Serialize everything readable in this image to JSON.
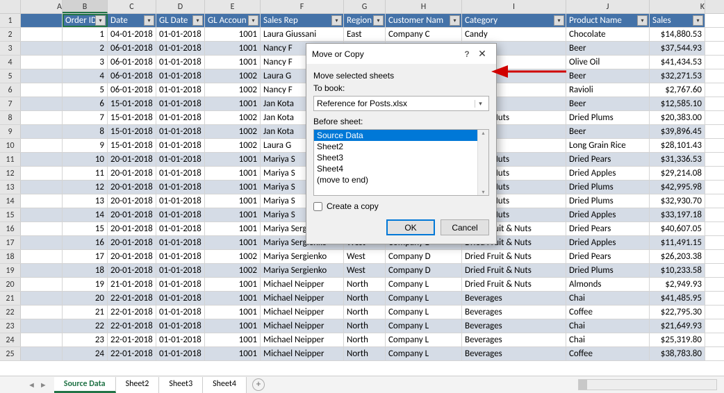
{
  "columns": [
    "A",
    "B",
    "C",
    "D",
    "E",
    "F",
    "G",
    "H",
    "I",
    "J",
    "K"
  ],
  "headers": [
    "",
    "Order ID",
    "Date",
    "GL Date",
    "GL Accoun",
    "Sales Rep",
    "Region",
    "Customer Nam",
    "Category",
    "Product Name",
    "Sales"
  ],
  "rows": [
    {
      "n": 1,
      "a": "",
      "b": "1",
      "c": "04-01-2018",
      "d": "01-01-2018",
      "e": "1001",
      "f": "Laura Giussani",
      "g": "East",
      "h": "Company C",
      "i": "Candy",
      "j": "Chocolate",
      "k": "$14,880.53"
    },
    {
      "n": 2,
      "a": "",
      "b": "2",
      "c": "06-01-2018",
      "d": "01-01-2018",
      "e": "1001",
      "f": "Nancy F",
      "g": "",
      "h": "",
      "i": "ges",
      "j": "Beer",
      "k": "$37,544.93"
    },
    {
      "n": 3,
      "a": "",
      "b": "3",
      "c": "06-01-2018",
      "d": "01-01-2018",
      "e": "1001",
      "f": "Nancy F",
      "g": "",
      "h": "",
      "i": "",
      "j": "Olive Oil",
      "k": "$41,434.53"
    },
    {
      "n": 4,
      "a": "",
      "b": "4",
      "c": "06-01-2018",
      "d": "01-01-2018",
      "e": "1002",
      "f": "Laura G",
      "g": "",
      "h": "",
      "i": "ges",
      "j": "Beer",
      "k": "$32,271.53"
    },
    {
      "n": 5,
      "a": "",
      "b": "5",
      "c": "06-01-2018",
      "d": "01-01-2018",
      "e": "1002",
      "f": "Nancy F",
      "g": "",
      "h": "",
      "i": "",
      "j": "Ravioli",
      "k": "$2,767.60"
    },
    {
      "n": 6,
      "a": "",
      "b": "6",
      "c": "15-01-2018",
      "d": "01-01-2018",
      "e": "1001",
      "f": "Jan Kota",
      "g": "",
      "h": "",
      "i": "ges",
      "j": "Beer",
      "k": "$12,585.10"
    },
    {
      "n": 7,
      "a": "",
      "b": "7",
      "c": "15-01-2018",
      "d": "01-01-2018",
      "e": "1002",
      "f": "Jan Kota",
      "g": "",
      "h": "",
      "i": "Fruit & Nuts",
      "j": "Dried Plums",
      "k": "$20,383.00"
    },
    {
      "n": 8,
      "a": "",
      "b": "8",
      "c": "15-01-2018",
      "d": "01-01-2018",
      "e": "1002",
      "f": "Jan Kota",
      "g": "",
      "h": "",
      "i": "ges",
      "j": "Beer",
      "k": "$39,896.45"
    },
    {
      "n": 9,
      "a": "",
      "b": "9",
      "c": "15-01-2018",
      "d": "01-01-2018",
      "e": "1002",
      "f": "Laura G",
      "g": "",
      "h": "",
      "i": "",
      "j": "Long Grain Rice",
      "k": "$28,101.43"
    },
    {
      "n": 10,
      "a": "",
      "b": "10",
      "c": "20-01-2018",
      "d": "01-01-2018",
      "e": "1001",
      "f": "Mariya S",
      "g": "",
      "h": "",
      "i": "Fruit & Nuts",
      "j": "Dried Pears",
      "k": "$31,336.53"
    },
    {
      "n": 11,
      "a": "",
      "b": "11",
      "c": "20-01-2018",
      "d": "01-01-2018",
      "e": "1001",
      "f": "Mariya S",
      "g": "",
      "h": "",
      "i": "Fruit & Nuts",
      "j": "Dried Apples",
      "k": "$29,214.08"
    },
    {
      "n": 12,
      "a": "",
      "b": "12",
      "c": "20-01-2018",
      "d": "01-01-2018",
      "e": "1001",
      "f": "Mariya S",
      "g": "",
      "h": "",
      "i": "Fruit & Nuts",
      "j": "Dried Plums",
      "k": "$42,995.98"
    },
    {
      "n": 13,
      "a": "",
      "b": "13",
      "c": "20-01-2018",
      "d": "01-01-2018",
      "e": "1001",
      "f": "Mariya S",
      "g": "",
      "h": "",
      "i": "Fruit & Nuts",
      "j": "Dried Plums",
      "k": "$32,930.70"
    },
    {
      "n": 14,
      "a": "",
      "b": "14",
      "c": "20-01-2018",
      "d": "01-01-2018",
      "e": "1001",
      "f": "Mariya S",
      "g": "",
      "h": "",
      "i": "Fruit & Nuts",
      "j": "Dried Apples",
      "k": "$33,197.18"
    },
    {
      "n": 15,
      "a": "",
      "b": "15",
      "c": "20-01-2018",
      "d": "01-01-2018",
      "e": "1001",
      "f": "Mariya Sergienko",
      "g": "West",
      "h": "Company D",
      "i": "Dried Fruit & Nuts",
      "j": "Dried Pears",
      "k": "$40,607.05"
    },
    {
      "n": 16,
      "a": "",
      "b": "16",
      "c": "20-01-2018",
      "d": "01-01-2018",
      "e": "1001",
      "f": "Mariya Sergienko",
      "g": "West",
      "h": "Company D",
      "i": "Dried Fruit & Nuts",
      "j": "Dried Apples",
      "k": "$11,491.15"
    },
    {
      "n": 17,
      "a": "",
      "b": "17",
      "c": "20-01-2018",
      "d": "01-01-2018",
      "e": "1002",
      "f": "Mariya Sergienko",
      "g": "West",
      "h": "Company D",
      "i": "Dried Fruit & Nuts",
      "j": "Dried Pears",
      "k": "$26,203.38"
    },
    {
      "n": 18,
      "a": "",
      "b": "18",
      "c": "20-01-2018",
      "d": "01-01-2018",
      "e": "1002",
      "f": "Mariya Sergienko",
      "g": "West",
      "h": "Company D",
      "i": "Dried Fruit & Nuts",
      "j": "Dried Plums",
      "k": "$10,233.58"
    },
    {
      "n": 19,
      "a": "",
      "b": "19",
      "c": "21-01-2018",
      "d": "01-01-2018",
      "e": "1001",
      "f": "Michael Neipper",
      "g": "North",
      "h": "Company L",
      "i": "Dried Fruit & Nuts",
      "j": "Almonds",
      "k": "$2,949.93"
    },
    {
      "n": 20,
      "a": "",
      "b": "20",
      "c": "22-01-2018",
      "d": "01-01-2018",
      "e": "1001",
      "f": "Michael Neipper",
      "g": "North",
      "h": "Company L",
      "i": "Beverages",
      "j": "Chai",
      "k": "$41,485.95"
    },
    {
      "n": 21,
      "a": "",
      "b": "21",
      "c": "22-01-2018",
      "d": "01-01-2018",
      "e": "1001",
      "f": "Michael Neipper",
      "g": "North",
      "h": "Company L",
      "i": "Beverages",
      "j": "Coffee",
      "k": "$22,795.30"
    },
    {
      "n": 22,
      "a": "",
      "b": "22",
      "c": "22-01-2018",
      "d": "01-01-2018",
      "e": "1001",
      "f": "Michael Neipper",
      "g": "North",
      "h": "Company L",
      "i": "Beverages",
      "j": "Chai",
      "k": "$21,649.93"
    },
    {
      "n": 23,
      "a": "",
      "b": "23",
      "c": "22-01-2018",
      "d": "01-01-2018",
      "e": "1001",
      "f": "Michael Neipper",
      "g": "North",
      "h": "Company L",
      "i": "Beverages",
      "j": "Chai",
      "k": "$25,319.80"
    },
    {
      "n": 24,
      "a": "",
      "b": "24",
      "c": "22-01-2018",
      "d": "01-01-2018",
      "e": "1001",
      "f": "Michael Neipper",
      "g": "North",
      "h": "Company L",
      "i": "Beverages",
      "j": "Coffee",
      "k": "$38,783.80"
    }
  ],
  "sheetTabs": [
    "Source Data",
    "Sheet2",
    "Sheet3",
    "Sheet4"
  ],
  "activeTab": "Source Data",
  "dialog": {
    "title": "Move or Copy",
    "moveLabel": "Move selected sheets",
    "toBookLabel": "To book:",
    "toBookValue": "Reference for Posts.xlsx",
    "beforeLabel": "Before sheet:",
    "listItems": [
      "Source Data",
      "Sheet2",
      "Sheet3",
      "Sheet4",
      "(move to end)"
    ],
    "selectedItem": "Source Data",
    "createCopyLabel": "Create a copy",
    "okLabel": "OK",
    "cancelLabel": "Cancel"
  }
}
